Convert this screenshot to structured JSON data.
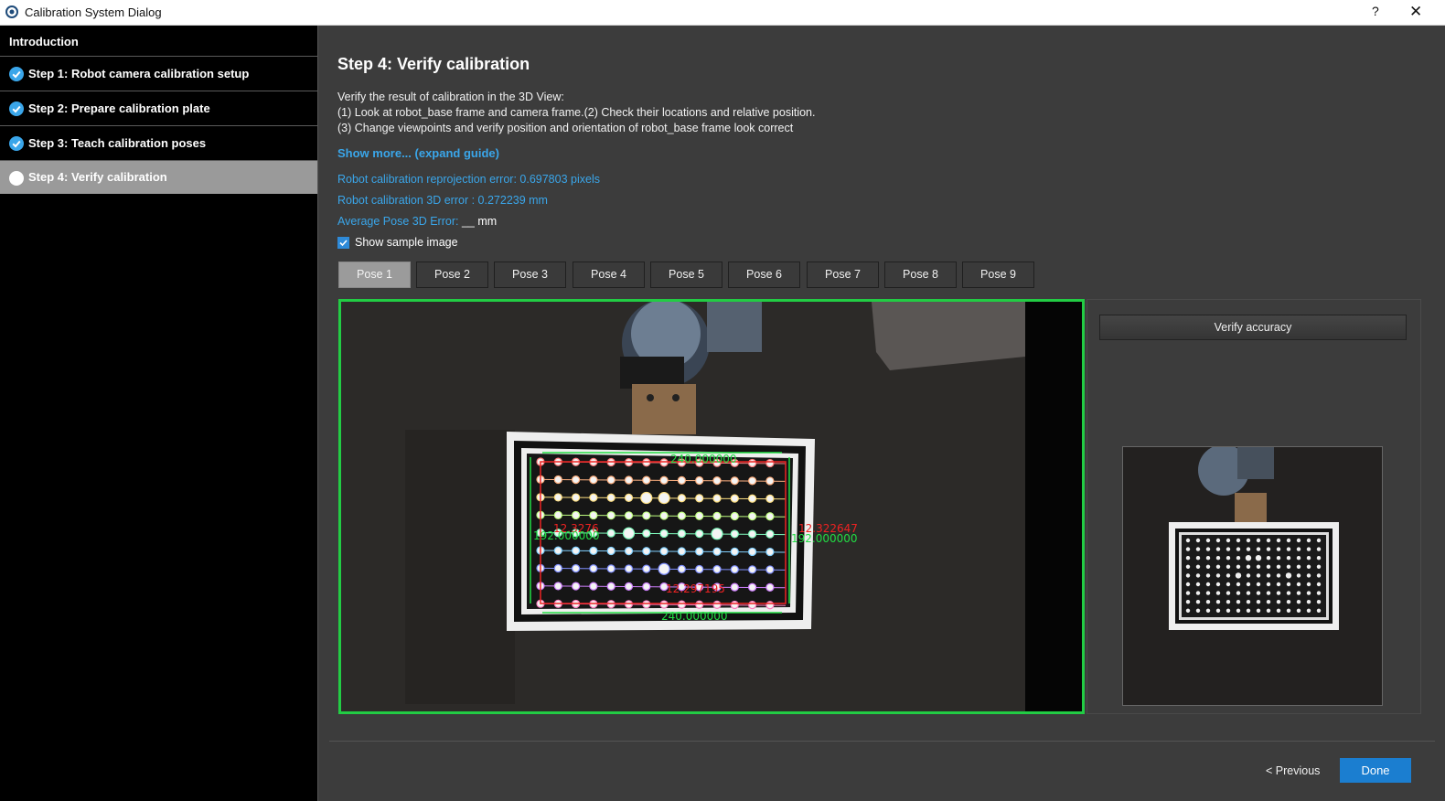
{
  "window": {
    "title": "Calibration System Dialog",
    "help": "?",
    "close": "✕"
  },
  "sidebar": {
    "items": [
      {
        "label": "Introduction",
        "state": "none"
      },
      {
        "label": "Step 1: Robot camera calibration setup",
        "state": "done"
      },
      {
        "label": "Step 2: Prepare calibration plate",
        "state": "done"
      },
      {
        "label": "Step 3: Teach calibration poses",
        "state": "done"
      },
      {
        "label": "Step 4: Verify calibration",
        "state": "active"
      }
    ]
  },
  "main": {
    "heading": "Step 4: Verify calibration",
    "description": [
      "Verify the result of calibration in the 3D View:",
      "(1) Look at robot_base frame and camera frame.(2) Check their locations and relative position.",
      "(3) Change viewpoints and verify position and orientation of robot_base frame look correct"
    ],
    "show_more": "Show more... (expand guide)",
    "metrics": {
      "reprojection": "Robot calibration reprojection error: 0.697803 pixels",
      "error_3d": "Robot calibration 3D error : 0.272239 mm",
      "avg_label": "Average Pose 3D Error:",
      "avg_value": "__ mm"
    },
    "show_sample": {
      "label": "Show sample image",
      "checked": true
    },
    "poses": [
      "Pose 1",
      "Pose 2",
      "Pose 3",
      "Pose 4",
      "Pose 5",
      "Pose 6",
      "Pose 7",
      "Pose 8",
      "Pose 9"
    ],
    "active_pose": "Pose 1",
    "overlay_labels": {
      "top": "240.000000",
      "left_red": "12.3276",
      "left_green": "192.000000",
      "right_red": "12.322647",
      "right_green": "192.000000",
      "bottom_red": "12.297195",
      "bottom_green": "240.000000"
    },
    "verify_button": "Verify accuracy"
  },
  "footer": {
    "previous": "< Previous",
    "done": "Done"
  },
  "colors": {
    "accent": "#3aa6ea",
    "frame_highlight": "#22cc44",
    "done_button": "#1b7ed0"
  }
}
